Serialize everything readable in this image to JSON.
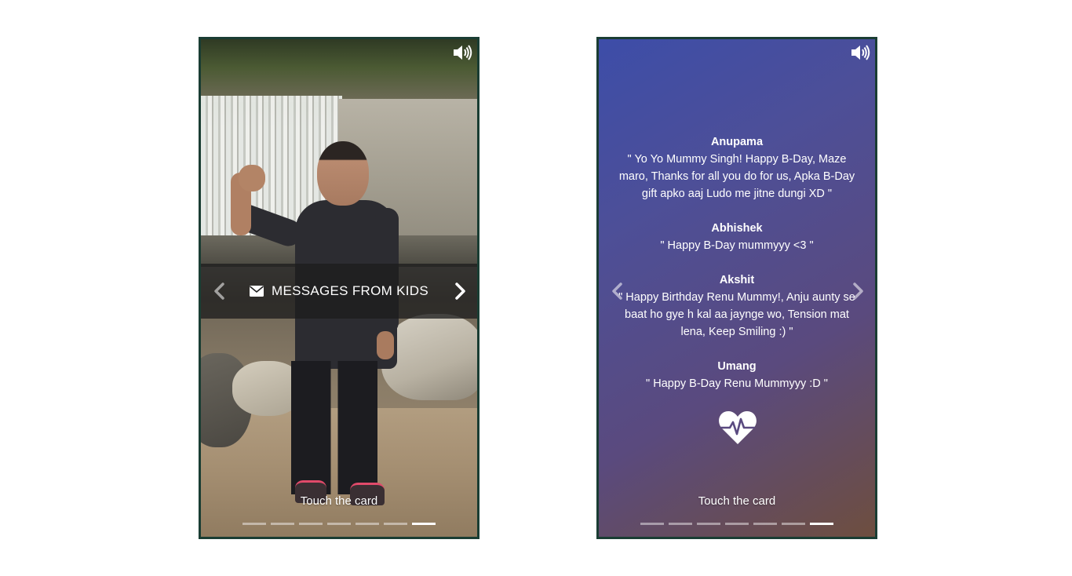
{
  "left_card": {
    "banner_title": "MESSAGES FROM KIDS",
    "touch_hint": "Touch the card",
    "progress": {
      "total": 7,
      "active_index": 6
    }
  },
  "right_card": {
    "messages": [
      {
        "name": "Anupama",
        "text": "\" Yo Yo Mummy Singh! Happy B-Day, Maze maro, Thanks for all you do for us, Apka B-Day gift apko aaj Ludo me jitne dungi XD \""
      },
      {
        "name": "Abhishek",
        "text": "\" Happy B-Day mummyyy <3 \""
      },
      {
        "name": "Akshit",
        "text": "\" Happy Birthday Renu Mummy!, Anju aunty se baat ho gye h kal aa jaynge wo, Tension mat lena, Keep Smiling :) \""
      },
      {
        "name": "Umang",
        "text": "\" Happy B-Day Renu Mummyyy :D \""
      }
    ],
    "touch_hint": "Touch the card",
    "progress": {
      "total": 7,
      "active_index": 6
    }
  },
  "icons": {
    "sound": "speaker-volume-icon",
    "envelope": "envelope-icon",
    "heart": "heart-pulse-icon",
    "prev": "chevron-left-icon",
    "next": "chevron-right-icon"
  },
  "colors": {
    "card_border": "#1a3d33",
    "banner_bg": "#1e1e1e",
    "gradient_start": "#3d4da8",
    "gradient_end": "#6e4e3f"
  }
}
